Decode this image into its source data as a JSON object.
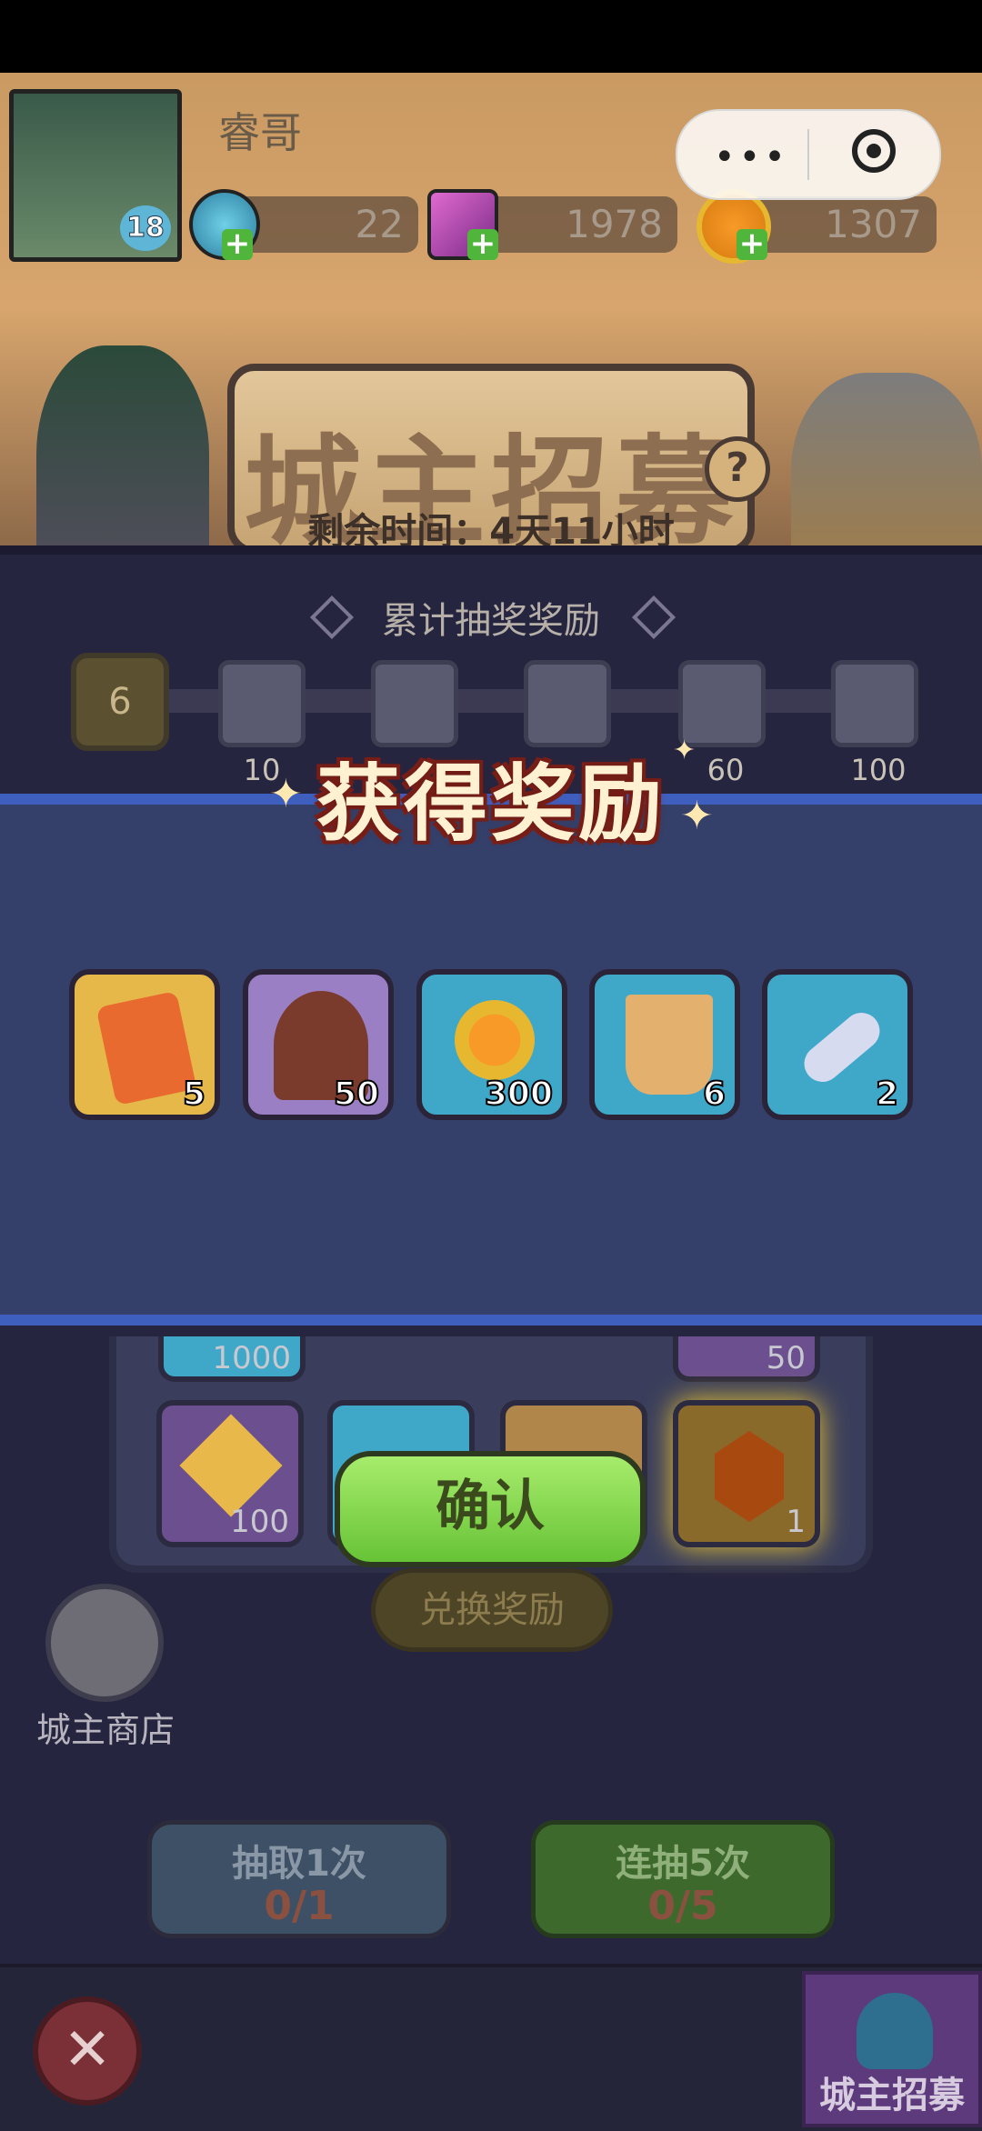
{
  "player": {
    "name": "睿哥",
    "level": "18"
  },
  "resources": [
    {
      "icon": "blue-gem-icon",
      "value": "22"
    },
    {
      "icon": "pink-crystal-icon",
      "value": "1978"
    },
    {
      "icon": "gold-coin-icon",
      "value": "1307"
    }
  ],
  "banner": {
    "title": "城主招募",
    "help": "?",
    "time_left": "剩余时间：4天11小时"
  },
  "cumulative": {
    "title": "累计抽奖奖励",
    "current": "6",
    "milestones": [
      "10",
      "",
      "",
      "60",
      "100"
    ]
  },
  "reward_popup": {
    "title": "获得奖励",
    "items": [
      {
        "icon": "crown-shield-icon",
        "count": "5",
        "bg": "#e6b84a"
      },
      {
        "icon": "hooded-hero-icon",
        "count": "50",
        "bg": "#9a7fc4"
      },
      {
        "icon": "gold-coin-icon",
        "count": "300",
        "bg": "#3fa8c9"
      },
      {
        "icon": "banner-scroll-icon",
        "count": "6",
        "bg": "#3fa8c9"
      },
      {
        "icon": "silver-key-icon",
        "count": "2",
        "bg": "#3fa8c9"
      }
    ],
    "confirm": "确认"
  },
  "grid": {
    "row1_counts": [
      "1000",
      "50"
    ],
    "row2_counts": [
      "100",
      "",
      "",
      "1"
    ]
  },
  "exchange_button": "兑换奖励",
  "shop": {
    "label": "城主商店"
  },
  "draw_once": {
    "label": "抽取1次",
    "count": "0/1"
  },
  "draw_five": {
    "label": "连抽5次",
    "count": "0/5"
  },
  "bottom_tab": {
    "label": "城主招募"
  },
  "close": "✕"
}
